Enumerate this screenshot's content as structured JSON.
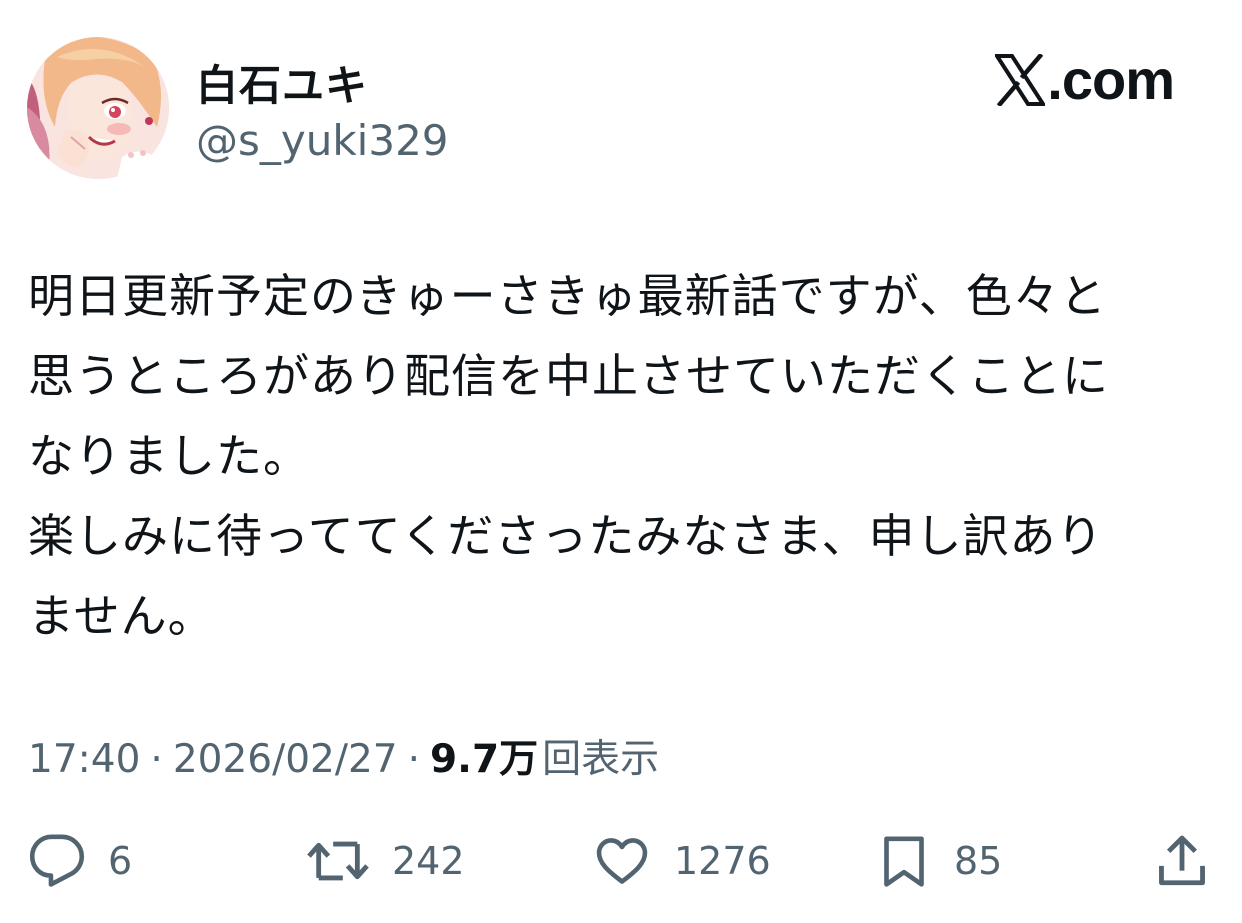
{
  "author": {
    "display_name": "白石ユキ",
    "handle": "@s_yuki329"
  },
  "brand": {
    "label": ".com",
    "icon": "x-logo-icon"
  },
  "tweet": {
    "lines": [
      "明日更新予定のきゅーさきゅ最新話ですが、色々と",
      "思うところがあり配信を中止させていただくことに",
      "なりました。",
      "楽しみに待っててくださったみなさま、申し訳あり",
      "ません。"
    ]
  },
  "meta": {
    "time": "17:40",
    "separator": "·",
    "date": "2026/02/27",
    "views_count": "9.7万",
    "views_label": "回表示"
  },
  "actions": {
    "reply": {
      "icon": "reply-icon",
      "count": "6"
    },
    "repost": {
      "icon": "repost-icon",
      "count": "242"
    },
    "like": {
      "icon": "heart-icon",
      "count": "1276"
    },
    "bookmark": {
      "icon": "bookmark-icon",
      "count": "85"
    },
    "share": {
      "icon": "share-icon"
    }
  },
  "colors": {
    "text_primary": "#0f1419",
    "text_secondary": "#536471",
    "background": "#ffffff"
  }
}
